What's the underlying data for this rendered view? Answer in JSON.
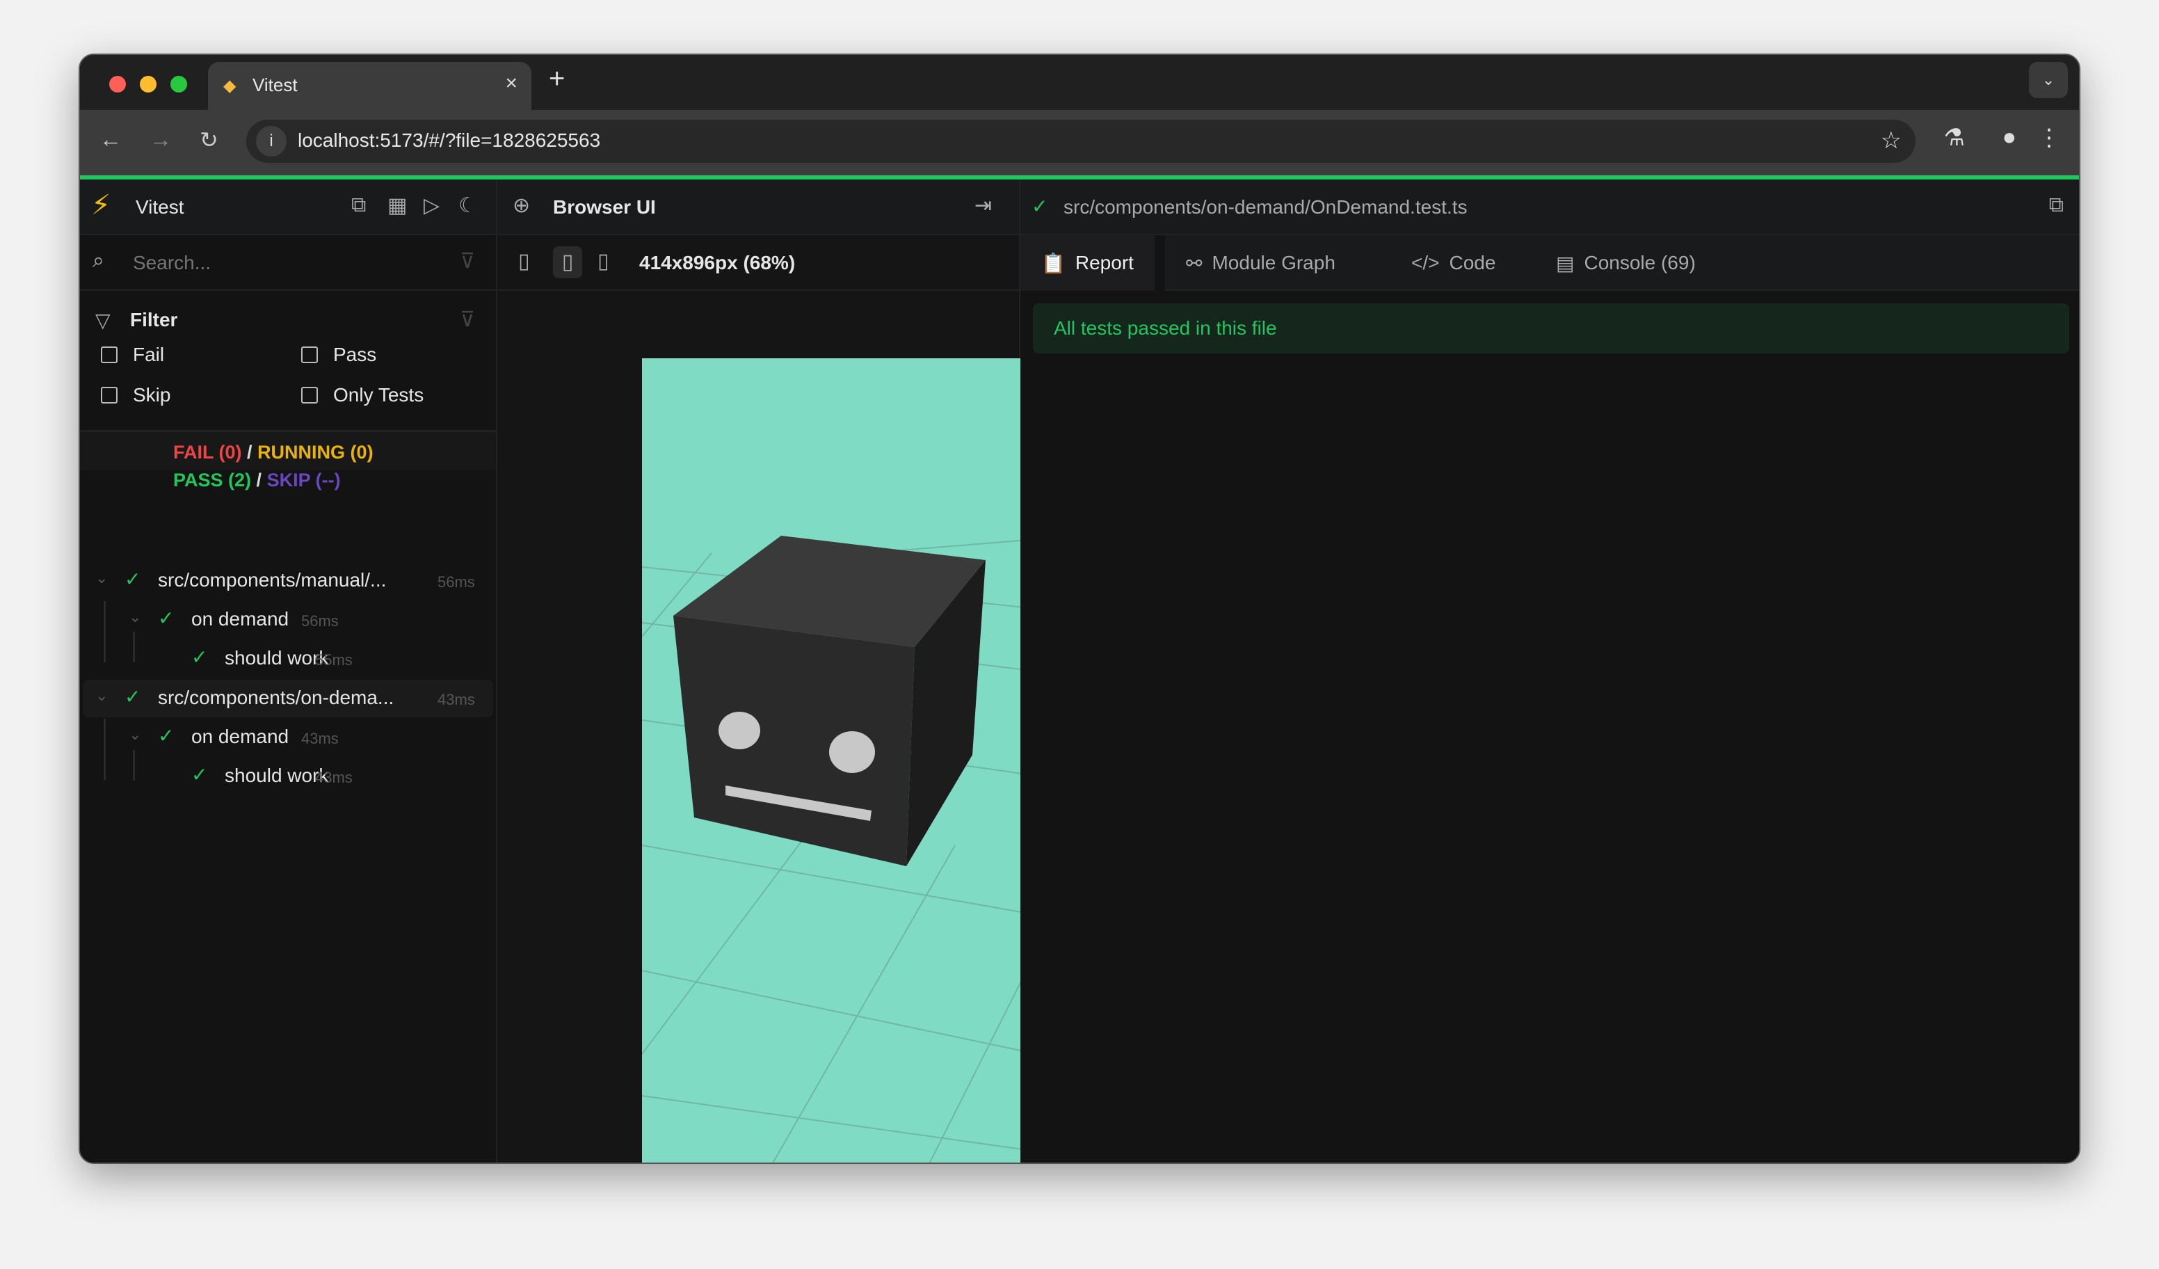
{
  "browser": {
    "tab_title": "Vitest",
    "url": "localhost:5173/#/?file=1828625563",
    "new_tab": "+",
    "close": "×"
  },
  "sidebar": {
    "app_name": "Vitest",
    "search_placeholder": "Search...",
    "filter": {
      "title": "Filter",
      "options": [
        "Fail",
        "Pass",
        "Skip",
        "Only Tests"
      ]
    },
    "summary": {
      "fail": "FAIL (0)",
      "running": "RUNNING (0)",
      "pass": "PASS (2)",
      "skip": "SKIP (--)",
      "sep": "/"
    },
    "tree": [
      {
        "label": "src/components/manual/...",
        "time": "56ms",
        "level": 0
      },
      {
        "label": "on demand",
        "time": "56ms",
        "level": 1
      },
      {
        "label": "should work",
        "time": "55ms",
        "level": 2
      },
      {
        "label": "src/components/on-dema...",
        "time": "43ms",
        "level": 0
      },
      {
        "label": "on demand",
        "time": "43ms",
        "level": 1
      },
      {
        "label": "should work",
        "time": "43ms",
        "level": 2
      }
    ]
  },
  "browser_ui": {
    "title": "Browser UI",
    "viewport": "414x896px (68%)"
  },
  "file": {
    "path": "src/components/on-demand/OnDemand.test.ts",
    "tabs": [
      "Report",
      "Module Graph",
      "Code",
      "Console (69)"
    ],
    "status": "All tests passed in this file"
  },
  "colors": {
    "accent": "#22c55e",
    "fail": "#ef4444",
    "running": "#eab308",
    "skip": "#6b46c1",
    "scene": "#80dbc4"
  }
}
